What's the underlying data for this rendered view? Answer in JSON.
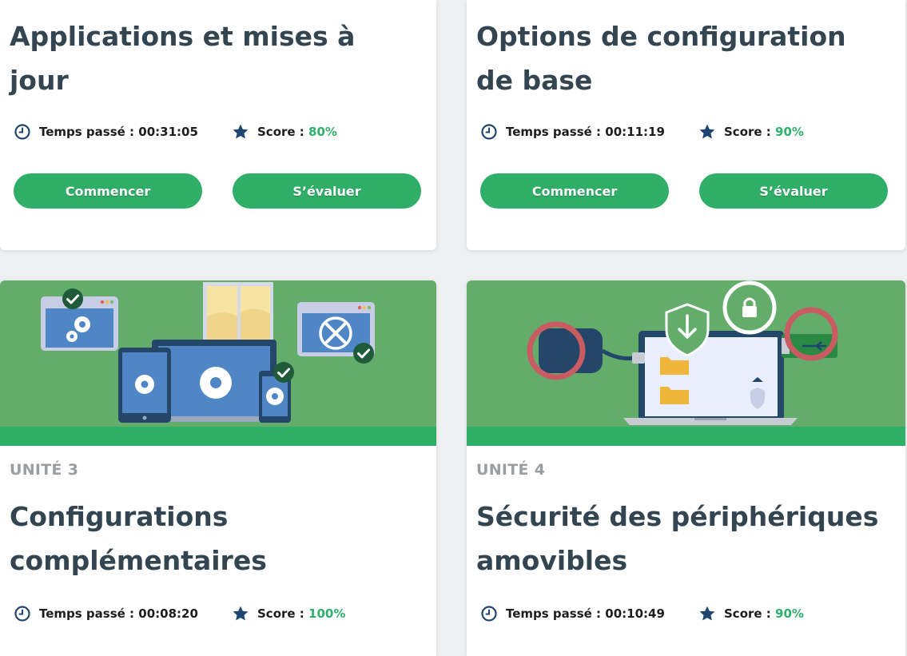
{
  "labels": {
    "time_prefix": "Temps passé : ",
    "score_prefix": "Score : ",
    "start_button": "Commencer",
    "evaluate_button": "S’évaluer"
  },
  "cards": [
    {
      "title": "Applications et mises à jour",
      "time_spent": "00:31:05",
      "score": "80%"
    },
    {
      "title": "Options de configuration de base",
      "time_spent": "00:11:19",
      "score": "90%"
    },
    {
      "unit": "UNITÉ 3",
      "title": "Configurations complémentaires",
      "time_spent": "00:08:20",
      "score": "100%"
    },
    {
      "unit": "UNITÉ 4",
      "title": "Sécurité des périphériques amovibles",
      "time_spent": "00:10:49",
      "score": "90%"
    }
  ],
  "icons": {
    "time": "clock-icon",
    "score": "star-icon"
  },
  "colors": {
    "accent_green": "#2eae66",
    "banner_green": "#63ac6a",
    "title_text": "#344552",
    "unit_text": "#9a9ea1",
    "icon_navy": "#1e4670",
    "page_background": "#eef0f2"
  }
}
